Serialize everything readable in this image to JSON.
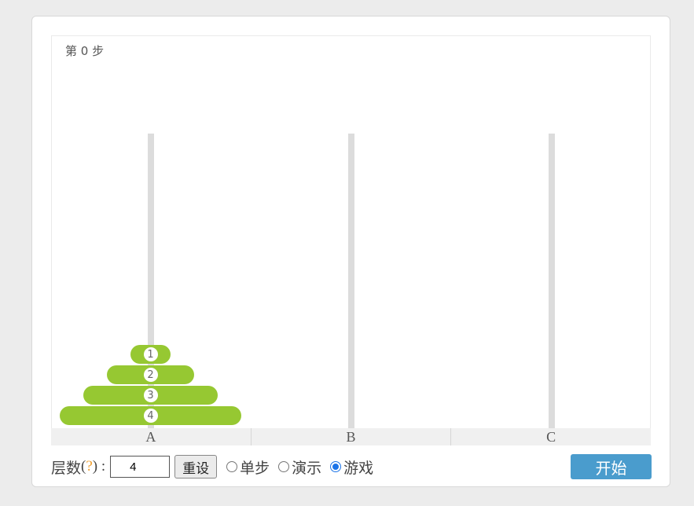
{
  "status": {
    "step_text": "第 0 步"
  },
  "towers": [
    {
      "label": "A",
      "disks": [
        1,
        2,
        3,
        4
      ]
    },
    {
      "label": "B",
      "disks": []
    },
    {
      "label": "C",
      "disks": []
    }
  ],
  "controls": {
    "level_label": "层数",
    "level_paren_open": "(",
    "help_mark": "?",
    "level_paren_close": ") :",
    "level_value": "4",
    "reset_label": "重设",
    "modes": [
      {
        "label": "单步",
        "selected": false
      },
      {
        "label": "演示",
        "selected": false
      },
      {
        "label": "游戏",
        "selected": true
      }
    ],
    "start_label": "开始"
  },
  "colors": {
    "disk": "#96c832",
    "rod": "#dcdcdc",
    "accent_button": "#4a9ccd",
    "help": "#f0a030"
  }
}
